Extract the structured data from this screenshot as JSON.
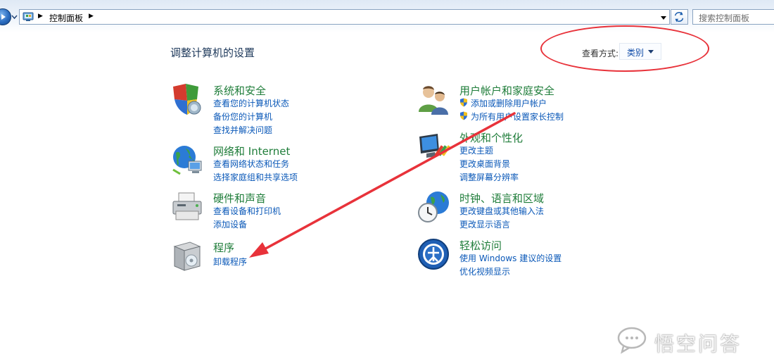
{
  "address_bar": {
    "breadcrumb": "控制面板",
    "search_placeholder": "搜索控制面板"
  },
  "header": {
    "title": "调整计算机的设置",
    "view_label": "查看方式:",
    "view_value": "类别"
  },
  "categories": [
    {
      "title": "系统和安全",
      "icon": "shield-security-icon",
      "links": [
        "查看您的计算机状态",
        "备份您的计算机",
        "查找并解决问题"
      ]
    },
    {
      "title": "网络和 Internet",
      "icon": "network-globe-icon",
      "links": [
        "查看网络状态和任务",
        "选择家庭组和共享选项"
      ]
    },
    {
      "title": "硬件和声音",
      "icon": "printer-hardware-icon",
      "links": [
        "查看设备和打印机",
        "添加设备"
      ]
    },
    {
      "title": "程序",
      "icon": "programs-box-icon",
      "links": [
        "卸载程序"
      ]
    },
    {
      "title": "用户帐户和家庭安全",
      "icon": "users-icon",
      "links": [
        "添加或删除用户帐户",
        "为所有用户设置家长控制"
      ]
    },
    {
      "title": "外观和个性化",
      "icon": "appearance-monitor-icon",
      "links": [
        "更改主题",
        "更改桌面背景",
        "调整屏幕分辨率"
      ]
    },
    {
      "title": "时钟、语言和区域",
      "icon": "clock-globe-icon",
      "links": [
        "更改键盘或其他输入法",
        "更改显示语言"
      ]
    },
    {
      "title": "轻松访问",
      "icon": "ease-of-access-icon",
      "links": [
        "使用 Windows 建议的设置",
        "优化视频显示"
      ]
    }
  ],
  "watermark": {
    "text": "悟空问答"
  },
  "colors": {
    "category_title": "#1f7d3a",
    "link": "#0a58b8",
    "annotation_red": "#e8323a"
  }
}
